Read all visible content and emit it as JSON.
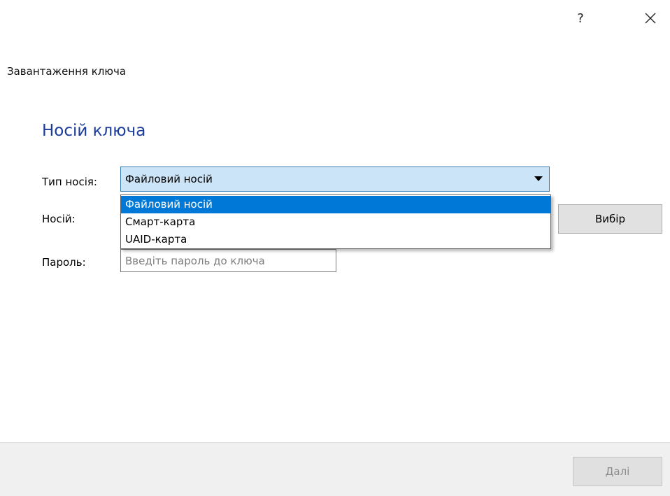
{
  "titlebar": {
    "help_label": "?",
    "close_icon": "close-icon"
  },
  "window": {
    "caption": "Завантаження ключа"
  },
  "section": {
    "heading": "Носій ключа"
  },
  "form": {
    "media_type_label": "Тип носія:",
    "media_type_value": "Файловий носій",
    "media_type_options": [
      "Файловий носій",
      "Смарт-карта",
      "UAID-карта"
    ],
    "media_type_selected_index": 0,
    "media_label": "Носій:",
    "choose_button": "Вибір",
    "password_label": "Пароль:",
    "password_placeholder": "Введіть пароль до ключа",
    "password_value": ""
  },
  "footer": {
    "next_button": "Далі",
    "next_enabled": false
  },
  "colors": {
    "heading": "#1a3b9a",
    "combo_background": "#cce4f7",
    "selection": "#0078d7",
    "footer_background": "#f0f0f0"
  }
}
